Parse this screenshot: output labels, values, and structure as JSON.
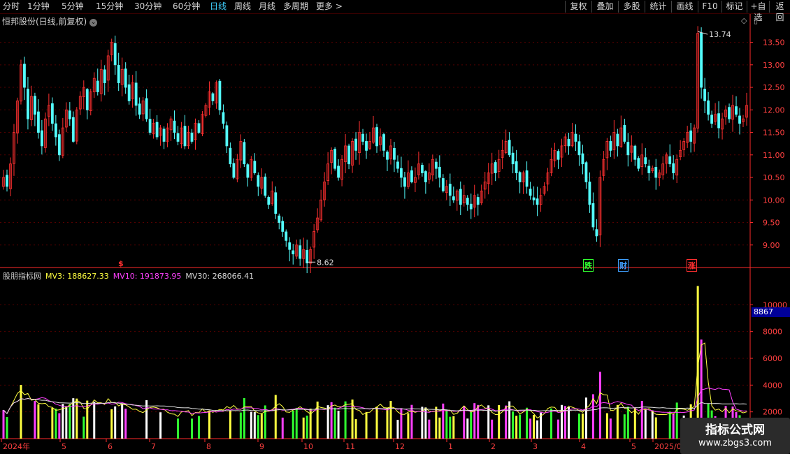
{
  "toolbar": {
    "periods": [
      "分时",
      "1分钟",
      "5分钟",
      "15分钟",
      "30分钟",
      "60分钟",
      "日线",
      "周线",
      "月线",
      "多周期",
      "更多 >"
    ],
    "active": "日线",
    "right_buttons": [
      "复权",
      "叠加",
      "多股",
      "统计",
      "画线",
      "F10",
      "标记",
      "+自选",
      "返回"
    ]
  },
  "stock_title": "恒邦股份(日线,前复权)",
  "top_right_icons": [
    "◇",
    "▯"
  ],
  "price_axis": {
    "ticks": [
      "13.50",
      "13.00",
      "12.50",
      "12.00",
      "11.50",
      "11.00",
      "10.50",
      "10.00",
      "9.50",
      "9.00"
    ],
    "min": 8.5,
    "max": 13.85
  },
  "price_annotations": {
    "high": "13.74",
    "low": "8.62"
  },
  "event_markers": [
    {
      "text": "$",
      "color": "#ff3030"
    },
    {
      "text": "跌",
      "color": "#30ff30"
    },
    {
      "text": "财",
      "color": "#3fa0ff"
    },
    {
      "text": "涨",
      "color": "#ff3030"
    }
  ],
  "indicator": {
    "name": "股朋指标网",
    "mv3_label": "MV3: 188627.33",
    "mv10_label": "MV10: 191873.95",
    "mv30_label": "MV30: 268066.41",
    "colors": {
      "mv3": "#ffff40",
      "mv10": "#ff40ff",
      "mv30": "#e0e0e0"
    },
    "axis_ticks": [
      "10000",
      "8000",
      "6000",
      "4000",
      "2000"
    ],
    "current_value": "8867"
  },
  "date_axis": [
    "2024年",
    "5",
    "6",
    "7",
    "8",
    "9",
    "10",
    "11",
    "12",
    "1",
    "2",
    "3",
    "4",
    "5",
    "2025/0"
  ],
  "watermark": {
    "line1": "指标公式网",
    "line2": "www.zbgs3.com"
  },
  "colors": {
    "up": "#ff3030",
    "down": "#54ffff",
    "grid": "#550000",
    "axis": "#ff2a2a",
    "bg": "#000000"
  },
  "chart_data": {
    "type": "candlestick",
    "title": "恒邦股份(日线,前复权)",
    "ylim": [
      8.5,
      13.85
    ],
    "close": [
      10.5,
      10.3,
      10.8,
      11.5,
      12.2,
      13.0,
      12.5,
      11.8,
      12.3,
      11.9,
      11.5,
      11.2,
      11.8,
      12.1,
      11.7,
      11.4,
      11.0,
      11.6,
      12.0,
      11.8,
      11.3,
      12.0,
      12.3,
      12.5,
      12.0,
      12.4,
      12.7,
      12.4,
      12.9,
      12.6,
      13.2,
      13.5,
      13.0,
      12.6,
      12.9,
      12.5,
      12.2,
      12.6,
      12.1,
      11.9,
      12.2,
      11.8,
      11.5,
      11.7,
      11.4,
      11.6,
      11.3,
      11.6,
      11.8,
      11.5,
      11.3,
      11.6,
      11.2,
      11.5,
      11.3,
      11.7,
      11.5,
      11.9,
      12.1,
      12.4,
      12.2,
      12.6,
      12.0,
      11.7,
      11.2,
      10.8,
      10.5,
      10.9,
      11.3,
      10.8,
      10.5,
      10.9,
      10.6,
      10.3,
      10.5,
      10.1,
      9.9,
      10.2,
      9.7,
      9.5,
      9.3,
      9.1,
      8.9,
      8.8,
      9.0,
      8.7,
      8.9,
      8.6,
      8.9,
      9.3,
      9.6,
      10.0,
      10.4,
      10.8,
      11.1,
      10.7,
      10.5,
      10.9,
      11.2,
      10.8,
      11.3,
      11.1,
      11.5,
      11.3,
      11.1,
      11.3,
      11.6,
      11.2,
      11.4,
      11.1,
      10.9,
      11.2,
      10.9,
      10.7,
      10.5,
      10.3,
      10.6,
      10.4,
      10.5,
      10.8,
      10.6,
      10.4,
      10.6,
      10.9,
      10.7,
      10.5,
      10.2,
      10.3,
      10.1,
      10.0,
      10.2,
      9.9,
      10.1,
      9.9,
      9.8,
      10.1,
      9.9,
      10.2,
      10.4,
      10.6,
      10.8,
      10.6,
      10.9,
      11.1,
      11.3,
      11.0,
      10.8,
      10.6,
      10.4,
      10.6,
      10.3,
      10.1,
      10.0,
      9.9,
      10.1,
      10.3,
      10.6,
      10.9,
      11.1,
      10.9,
      11.2,
      11.4,
      11.2,
      11.5,
      11.3,
      11.0,
      10.8,
      10.4,
      9.9,
      9.4,
      9.2,
      10.5,
      10.9,
      11.3,
      11.1,
      11.5,
      11.2,
      11.6,
      11.3,
      11.0,
      11.2,
      10.9,
      10.7,
      11.0,
      10.8,
      10.6,
      10.7,
      10.5,
      10.6,
      10.8,
      11.0,
      10.8,
      10.6,
      10.9,
      11.1,
      11.3,
      11.5,
      11.3,
      11.6,
      13.7,
      12.5,
      12.2,
      11.9,
      11.7,
      11.9,
      11.6,
      11.8,
      12.0,
      11.8,
      12.1,
      11.9,
      11.7,
      11.8,
      12.1
    ]
  }
}
